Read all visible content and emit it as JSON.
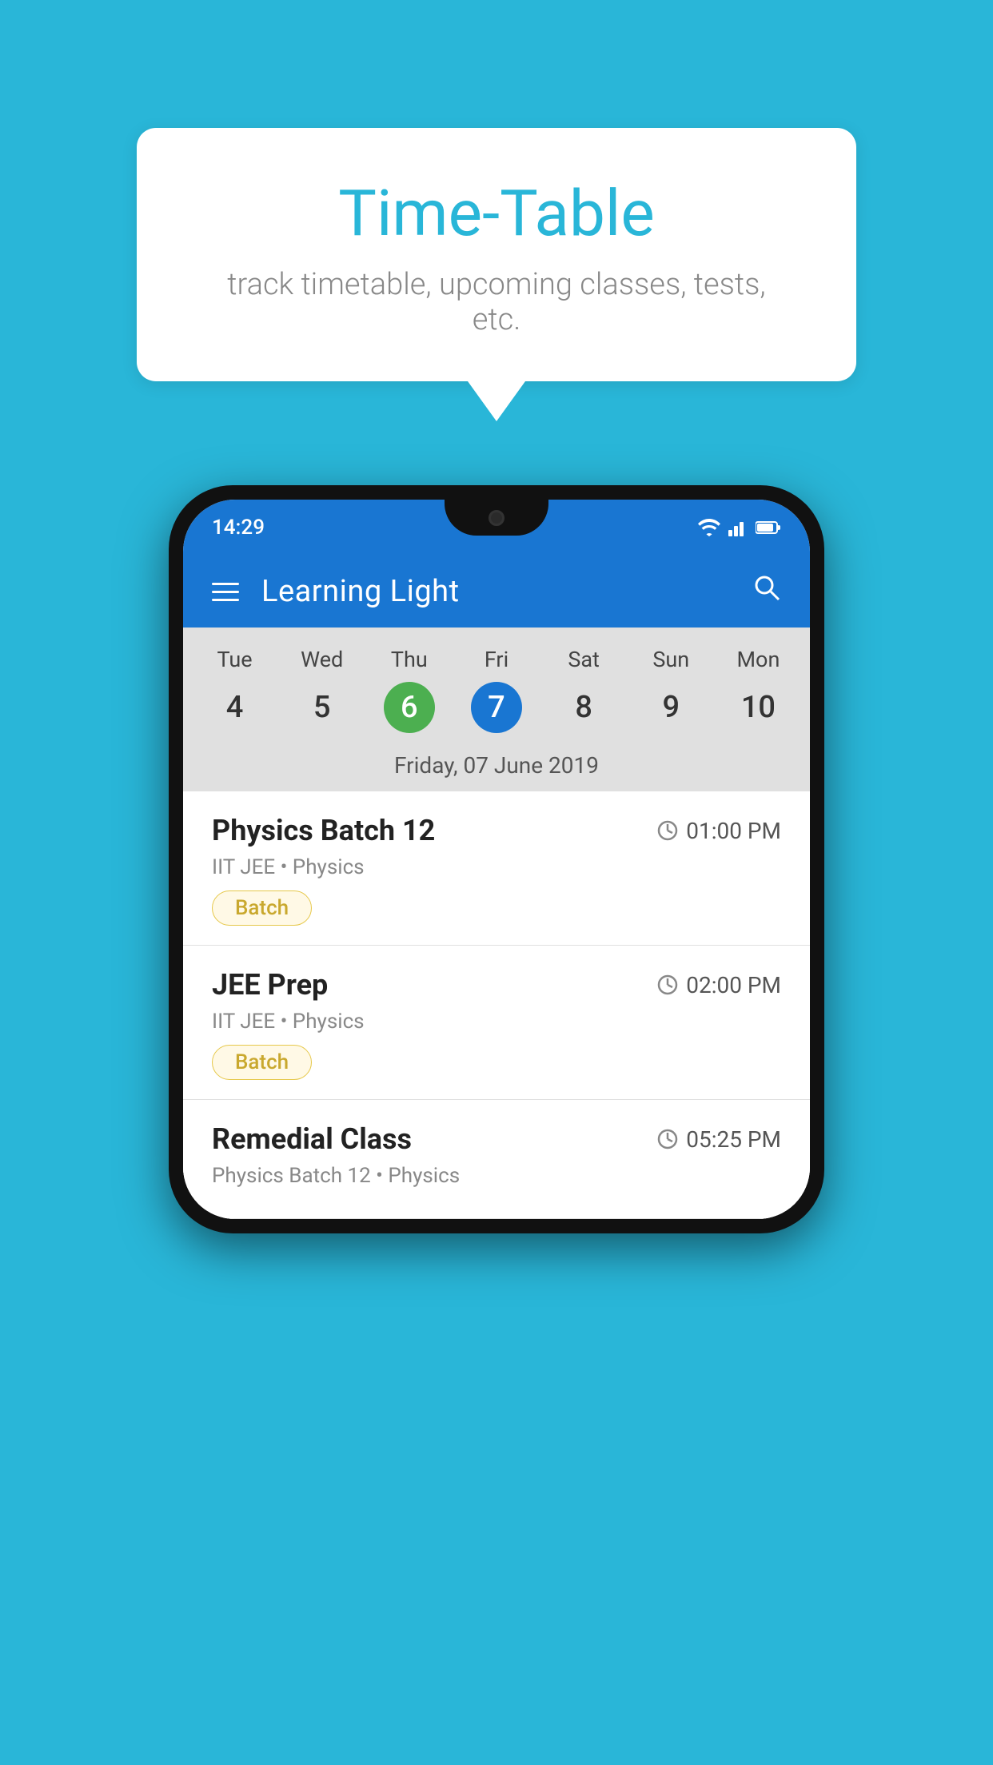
{
  "background_color": "#29b6d8",
  "speech_bubble": {
    "title": "Time-Table",
    "subtitle": "track timetable, upcoming classes, tests, etc."
  },
  "phone": {
    "status_bar": {
      "time": "14:29",
      "icons": [
        "wifi",
        "signal",
        "battery"
      ]
    },
    "app_bar": {
      "title": "Learning Light",
      "menu_icon": "menu",
      "search_icon": "search"
    },
    "calendar": {
      "days": [
        {
          "name": "Tue",
          "num": "4"
        },
        {
          "name": "Wed",
          "num": "5"
        },
        {
          "name": "Thu",
          "num": "6",
          "state": "today"
        },
        {
          "name": "Fri",
          "num": "7",
          "state": "selected"
        },
        {
          "name": "Sat",
          "num": "8"
        },
        {
          "name": "Sun",
          "num": "9"
        },
        {
          "name": "Mon",
          "num": "10"
        }
      ],
      "selected_date_label": "Friday, 07 June 2019"
    },
    "schedule": [
      {
        "title": "Physics Batch 12",
        "time": "01:00 PM",
        "subtitle": "IIT JEE • Physics",
        "tag": "Batch"
      },
      {
        "title": "JEE Prep",
        "time": "02:00 PM",
        "subtitle": "IIT JEE • Physics",
        "tag": "Batch"
      },
      {
        "title": "Remedial Class",
        "time": "05:25 PM",
        "subtitle": "Physics Batch 12 • Physics",
        "tag": ""
      }
    ]
  }
}
